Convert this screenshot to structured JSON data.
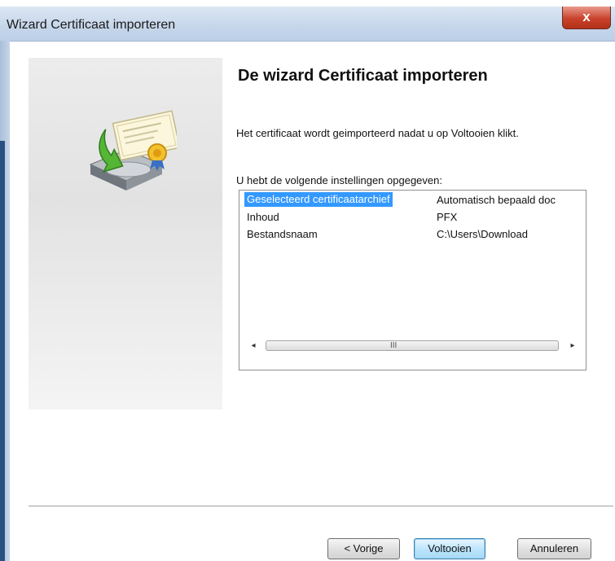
{
  "window": {
    "title": "Wizard Certificaat importeren",
    "close_label": "x"
  },
  "main": {
    "heading": "De wizard Certificaat importeren",
    "description": "Het certificaat wordt geimporteerd nadat u op Voltooien klikt.",
    "settings_label": "U hebt de volgende instellingen opgegeven:"
  },
  "settings": {
    "rows": [
      {
        "key": "Geselecteerd certificaatarchief",
        "value": "Automatisch bepaald doc"
      },
      {
        "key": "Inhoud",
        "value": "PFX"
      },
      {
        "key": "Bestandsnaam",
        "value": "C:\\Users\\Download"
      }
    ],
    "scroll_left": "◂",
    "scroll_right": "▸",
    "scroll_grip": "III"
  },
  "buttons": {
    "back": "< Vorige",
    "finish": "Voltooien",
    "cancel": "Annuleren"
  },
  "colors": {
    "selection": "#3399ff",
    "titlebar": "#c6d6ea",
    "close": "#c9422c"
  }
}
